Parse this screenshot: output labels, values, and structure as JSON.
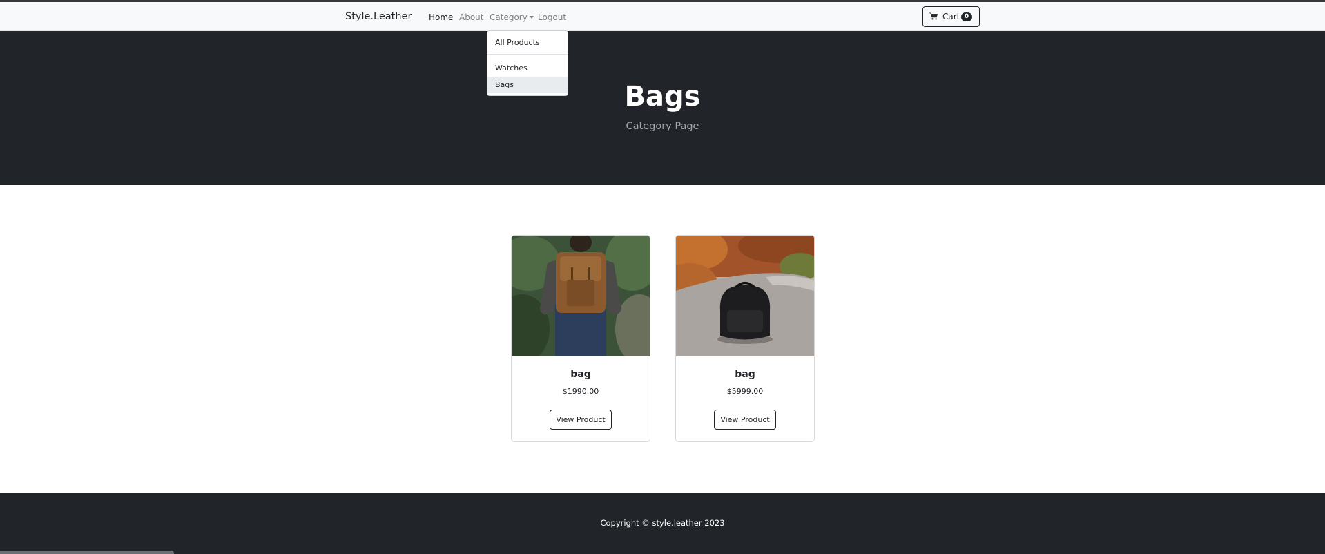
{
  "navbar": {
    "brand": "Style.Leather",
    "links": {
      "home": "Home",
      "about": "About",
      "category": "Category",
      "logout": "Logout"
    },
    "cart": {
      "label": "Cart",
      "count": "0",
      "icon": "cart-icon"
    }
  },
  "dropdown": {
    "items": [
      "All Products",
      "Watches",
      "Bags"
    ],
    "highlighted": "Bags"
  },
  "hero": {
    "title": "Bags",
    "subtitle": "Category Page"
  },
  "products": [
    {
      "name": "bag",
      "price": "$1990.00",
      "button": "View Product",
      "image": "brown leather backpack on person"
    },
    {
      "name": "bag",
      "price": "$5999.00",
      "button": "View Product",
      "image": "black backpack on road"
    }
  ],
  "footer": {
    "text": "Copyright © style.leather 2023"
  },
  "colors": {
    "dark": "#212529",
    "navbar_bg": "#f8f9fa",
    "muted": "#7c7f82"
  }
}
